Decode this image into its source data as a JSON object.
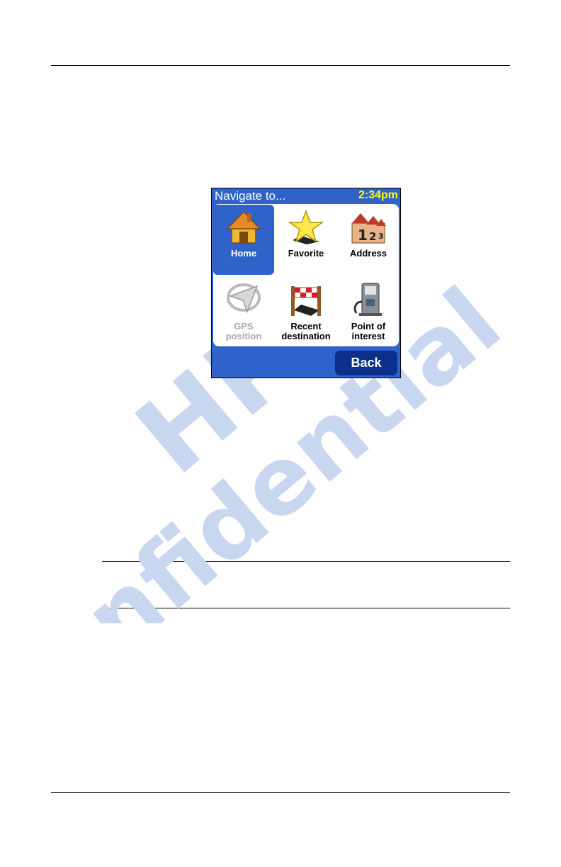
{
  "watermark": {
    "line1": "HP",
    "line2": "Confidential"
  },
  "device": {
    "title": "Navigate to...",
    "clock": "2:34pm",
    "tiles": [
      {
        "line1": "Home",
        "line2": "",
        "icon": "house-icon",
        "state": "selected"
      },
      {
        "line1": "Favorite",
        "line2": "",
        "icon": "star-icon",
        "state": "normal"
      },
      {
        "line1": "Address",
        "line2": "",
        "icon": "houses-123-icon",
        "state": "normal"
      },
      {
        "line1": "GPS",
        "line2": "position",
        "icon": "gps-icon",
        "state": "disabled"
      },
      {
        "line1": "Recent",
        "line2": "destination",
        "icon": "checkered-flag-icon",
        "state": "normal"
      },
      {
        "line1": "Point of",
        "line2": "interest",
        "icon": "fuel-pump-icon",
        "state": "normal"
      }
    ],
    "back_label": "Back"
  },
  "colors": {
    "accent": "#2f63c9",
    "button": "#0d2f8c",
    "clock": "#ffff00",
    "watermark": "#c8d6ef"
  }
}
